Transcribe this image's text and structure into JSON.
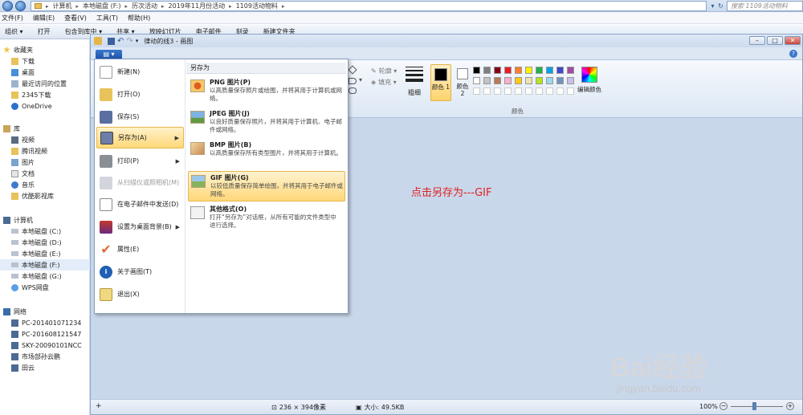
{
  "explorer": {
    "address": {
      "segments": [
        "计算机",
        "本地磁盘 (F:)",
        "历次活动",
        "2019年11月份活动",
        "1109活动物料"
      ]
    },
    "search_placeholder": "搜索 1109活动物料",
    "menubar": [
      "文件(F)",
      "编辑(E)",
      "查看(V)",
      "工具(T)",
      "帮助(H)"
    ],
    "toolbar": [
      "组织 ▾",
      "打开",
      "包含到库中 ▾",
      "共享 ▾",
      "放映幻灯片",
      "电子邮件",
      "刻录",
      "新建文件夹"
    ],
    "nav": {
      "favorites_title": "收藏夹",
      "favorites": [
        "下载",
        "桌面",
        "最近访问的位置",
        "2345下载",
        "OneDrive"
      ],
      "libraries_title": "库",
      "libraries": [
        "视频",
        "腾讯视频",
        "图片",
        "文档",
        "音乐",
        "优酷影视库"
      ],
      "computer_title": "计算机",
      "drives": [
        "本地磁盘 (C:)",
        "本地磁盘 (D:)",
        "本地磁盘 (E:)",
        "本地磁盘 (F:)",
        "本地磁盘 (G:)",
        "WPS网盘"
      ],
      "network_title": "网络",
      "network": [
        "PC-201401071234",
        "PC-201608121547",
        "SKY-20090101NCC",
        "市场部孙云鹏",
        "田云"
      ]
    }
  },
  "paint": {
    "title": "律动的线3 - 画图",
    "ribbon": {
      "outline_label": "轮廓 ▾",
      "fill_label": "填充 ▾",
      "size_label": "粗细",
      "color1_label": "颜色 1",
      "color2_label": "颜色 2",
      "edit_colors_label": "编辑颜色",
      "colors_group_label": "颜色"
    },
    "status": {
      "dimensions": "236 × 394像素",
      "size": "大小: 49.5KB",
      "zoom": "100%"
    },
    "palette": [
      "#000000",
      "#7f7f7f",
      "#880015",
      "#ed1c24",
      "#ff7f27",
      "#fff200",
      "#22b14c",
      "#00a2e8",
      "#3f48cc",
      "#a349a4",
      "#ffffff",
      "#c3c3c3",
      "#b97a57",
      "#ffaec9",
      "#ffc90e",
      "#efe4b0",
      "#b5e61d",
      "#99d9ea",
      "#7092be",
      "#c8bfe7"
    ]
  },
  "file_menu": {
    "items": [
      {
        "label": "新建(N)",
        "disabled": false,
        "arrow": false
      },
      {
        "label": "打开(O)",
        "disabled": false,
        "arrow": false
      },
      {
        "label": "保存(S)",
        "disabled": false,
        "arrow": false
      },
      {
        "label": "另存为(A)",
        "disabled": false,
        "arrow": true
      },
      {
        "label": "打印(P)",
        "disabled": false,
        "arrow": true
      },
      {
        "label": "从扫描仪或照相机(M)",
        "disabled": true,
        "arrow": false
      },
      {
        "label": "在电子邮件中发送(D)",
        "disabled": false,
        "arrow": false
      },
      {
        "label": "设置为桌面背景(B)",
        "disabled": false,
        "arrow": true
      },
      {
        "label": "属性(E)",
        "disabled": false,
        "arrow": false
      },
      {
        "label": "关于画图(T)",
        "disabled": false,
        "arrow": false
      },
      {
        "label": "退出(X)",
        "disabled": false,
        "arrow": false
      }
    ],
    "save_as": {
      "header": "另存为",
      "options": [
        {
          "title": "PNG 图片(P)",
          "desc": "以高质量保存照片或绘图，并将其用于计算机或网络。"
        },
        {
          "title": "JPEG 图片(J)",
          "desc": "以良好质量保存照片，并将其用于计算机、电子邮件或网络。"
        },
        {
          "title": "BMP 图片(B)",
          "desc": "以高质量保存所有类型图片，并将其用于计算机。"
        },
        {
          "title": "GIF 图片(G)",
          "desc": "以较低质量保存简单绘图，并将其用于电子邮件或网络。"
        },
        {
          "title": "其他格式(O)",
          "desc": "打开“另存为”对话框，从所有可能的文件类型中进行选择。"
        }
      ]
    }
  },
  "annotation": "点击另存为---GIF",
  "watermark": {
    "brand": "Bai经验",
    "url": "jingyan.baidu.com"
  }
}
